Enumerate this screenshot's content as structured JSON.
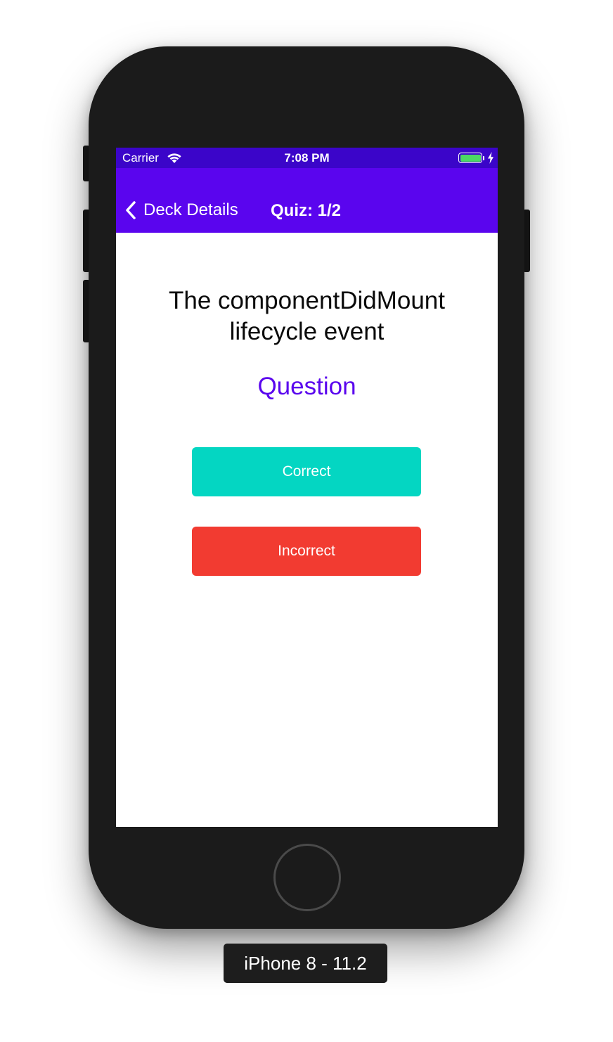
{
  "status_bar": {
    "carrier": "Carrier",
    "time": "7:08 PM",
    "wifi_icon": "wifi-icon",
    "battery_icon": "battery-icon",
    "charging_icon": "bolt-icon",
    "battery_level": 1.0
  },
  "nav_bar": {
    "back_label": "Deck Details",
    "back_icon": "chevron-left-icon",
    "title": "Quiz: 1/2"
  },
  "card": {
    "text": "The componentDidMount lifecycle event",
    "toggle_label": "Question"
  },
  "actions": {
    "correct_label": "Correct",
    "incorrect_label": "Incorrect"
  },
  "device": {
    "label": "iPhone 8 - 11.2"
  },
  "colors": {
    "status_bar_bg": "#3b05c9",
    "nav_bar_bg": "#5a05ee",
    "accent": "#5a05ee",
    "correct": "#04d6c2",
    "incorrect": "#f23b31",
    "phone_body": "#1b1b1b"
  }
}
